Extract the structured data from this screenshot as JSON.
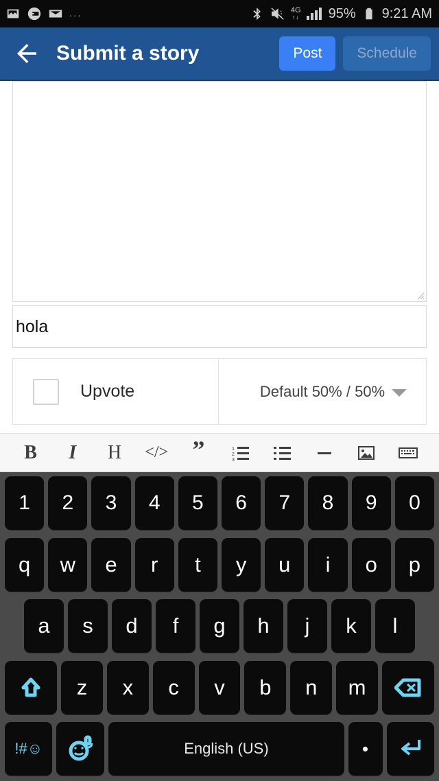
{
  "statusbar": {
    "left_icons": [
      "photo-icon",
      "download-circle-icon",
      "envelope-icon"
    ],
    "overflow": "...",
    "right_icons": [
      "bluetooth-icon",
      "vibrate-mute-icon",
      "signal-bars-icon",
      "battery-icon"
    ],
    "network": "4G",
    "battery_percent": "95%",
    "clock": "9:21 AM"
  },
  "appbar": {
    "back_icon": "arrow-left-icon",
    "title": "Submit a story",
    "post_label": "Post",
    "schedule_label": "Schedule",
    "bg_color": "#205493",
    "post_color": "#3b7ff5",
    "schedule_color": "#2c69ad"
  },
  "form": {
    "body_value": "",
    "body_placeholder": "",
    "title_value": "hola",
    "upvote_label": "Upvote",
    "upvote_checked": false,
    "reward_value": "Default 50% / 50%"
  },
  "format_toolbar": {
    "items": [
      {
        "name": "bold-icon",
        "glyph": "B"
      },
      {
        "name": "italic-icon",
        "glyph": "I"
      },
      {
        "name": "heading-icon",
        "glyph": "H"
      },
      {
        "name": "code-icon",
        "glyph": "</>"
      },
      {
        "name": "quote-icon",
        "glyph": "”"
      },
      {
        "name": "ordered-list-icon",
        "glyph": ""
      },
      {
        "name": "bullet-list-icon",
        "glyph": ""
      },
      {
        "name": "horizontal-rule-icon",
        "glyph": "—"
      },
      {
        "name": "image-icon",
        "glyph": ""
      },
      {
        "name": "keyboard-icon",
        "glyph": ""
      }
    ]
  },
  "keyboard": {
    "row_numbers": [
      "1",
      "2",
      "3",
      "4",
      "5",
      "6",
      "7",
      "8",
      "9",
      "0"
    ],
    "row_top": [
      "q",
      "w",
      "e",
      "r",
      "t",
      "y",
      "u",
      "i",
      "o",
      "p"
    ],
    "row_home": [
      "a",
      "s",
      "d",
      "f",
      "g",
      "h",
      "j",
      "k",
      "l"
    ],
    "row_bottom": [
      "z",
      "x",
      "c",
      "v",
      "b",
      "n",
      "m"
    ],
    "shift_icon": "shift-arrow-icon",
    "backspace_icon": "backspace-icon",
    "symbols_label": "!#☺",
    "emoji_icon": "emoji-mic-icon",
    "space_label": "English (US)",
    "period_label": ".",
    "enter_icon": "enter-return-icon",
    "bg_color": "#4a4a4a",
    "key_color": "#0b0b0b",
    "accent_color": "#6fd3f2"
  }
}
